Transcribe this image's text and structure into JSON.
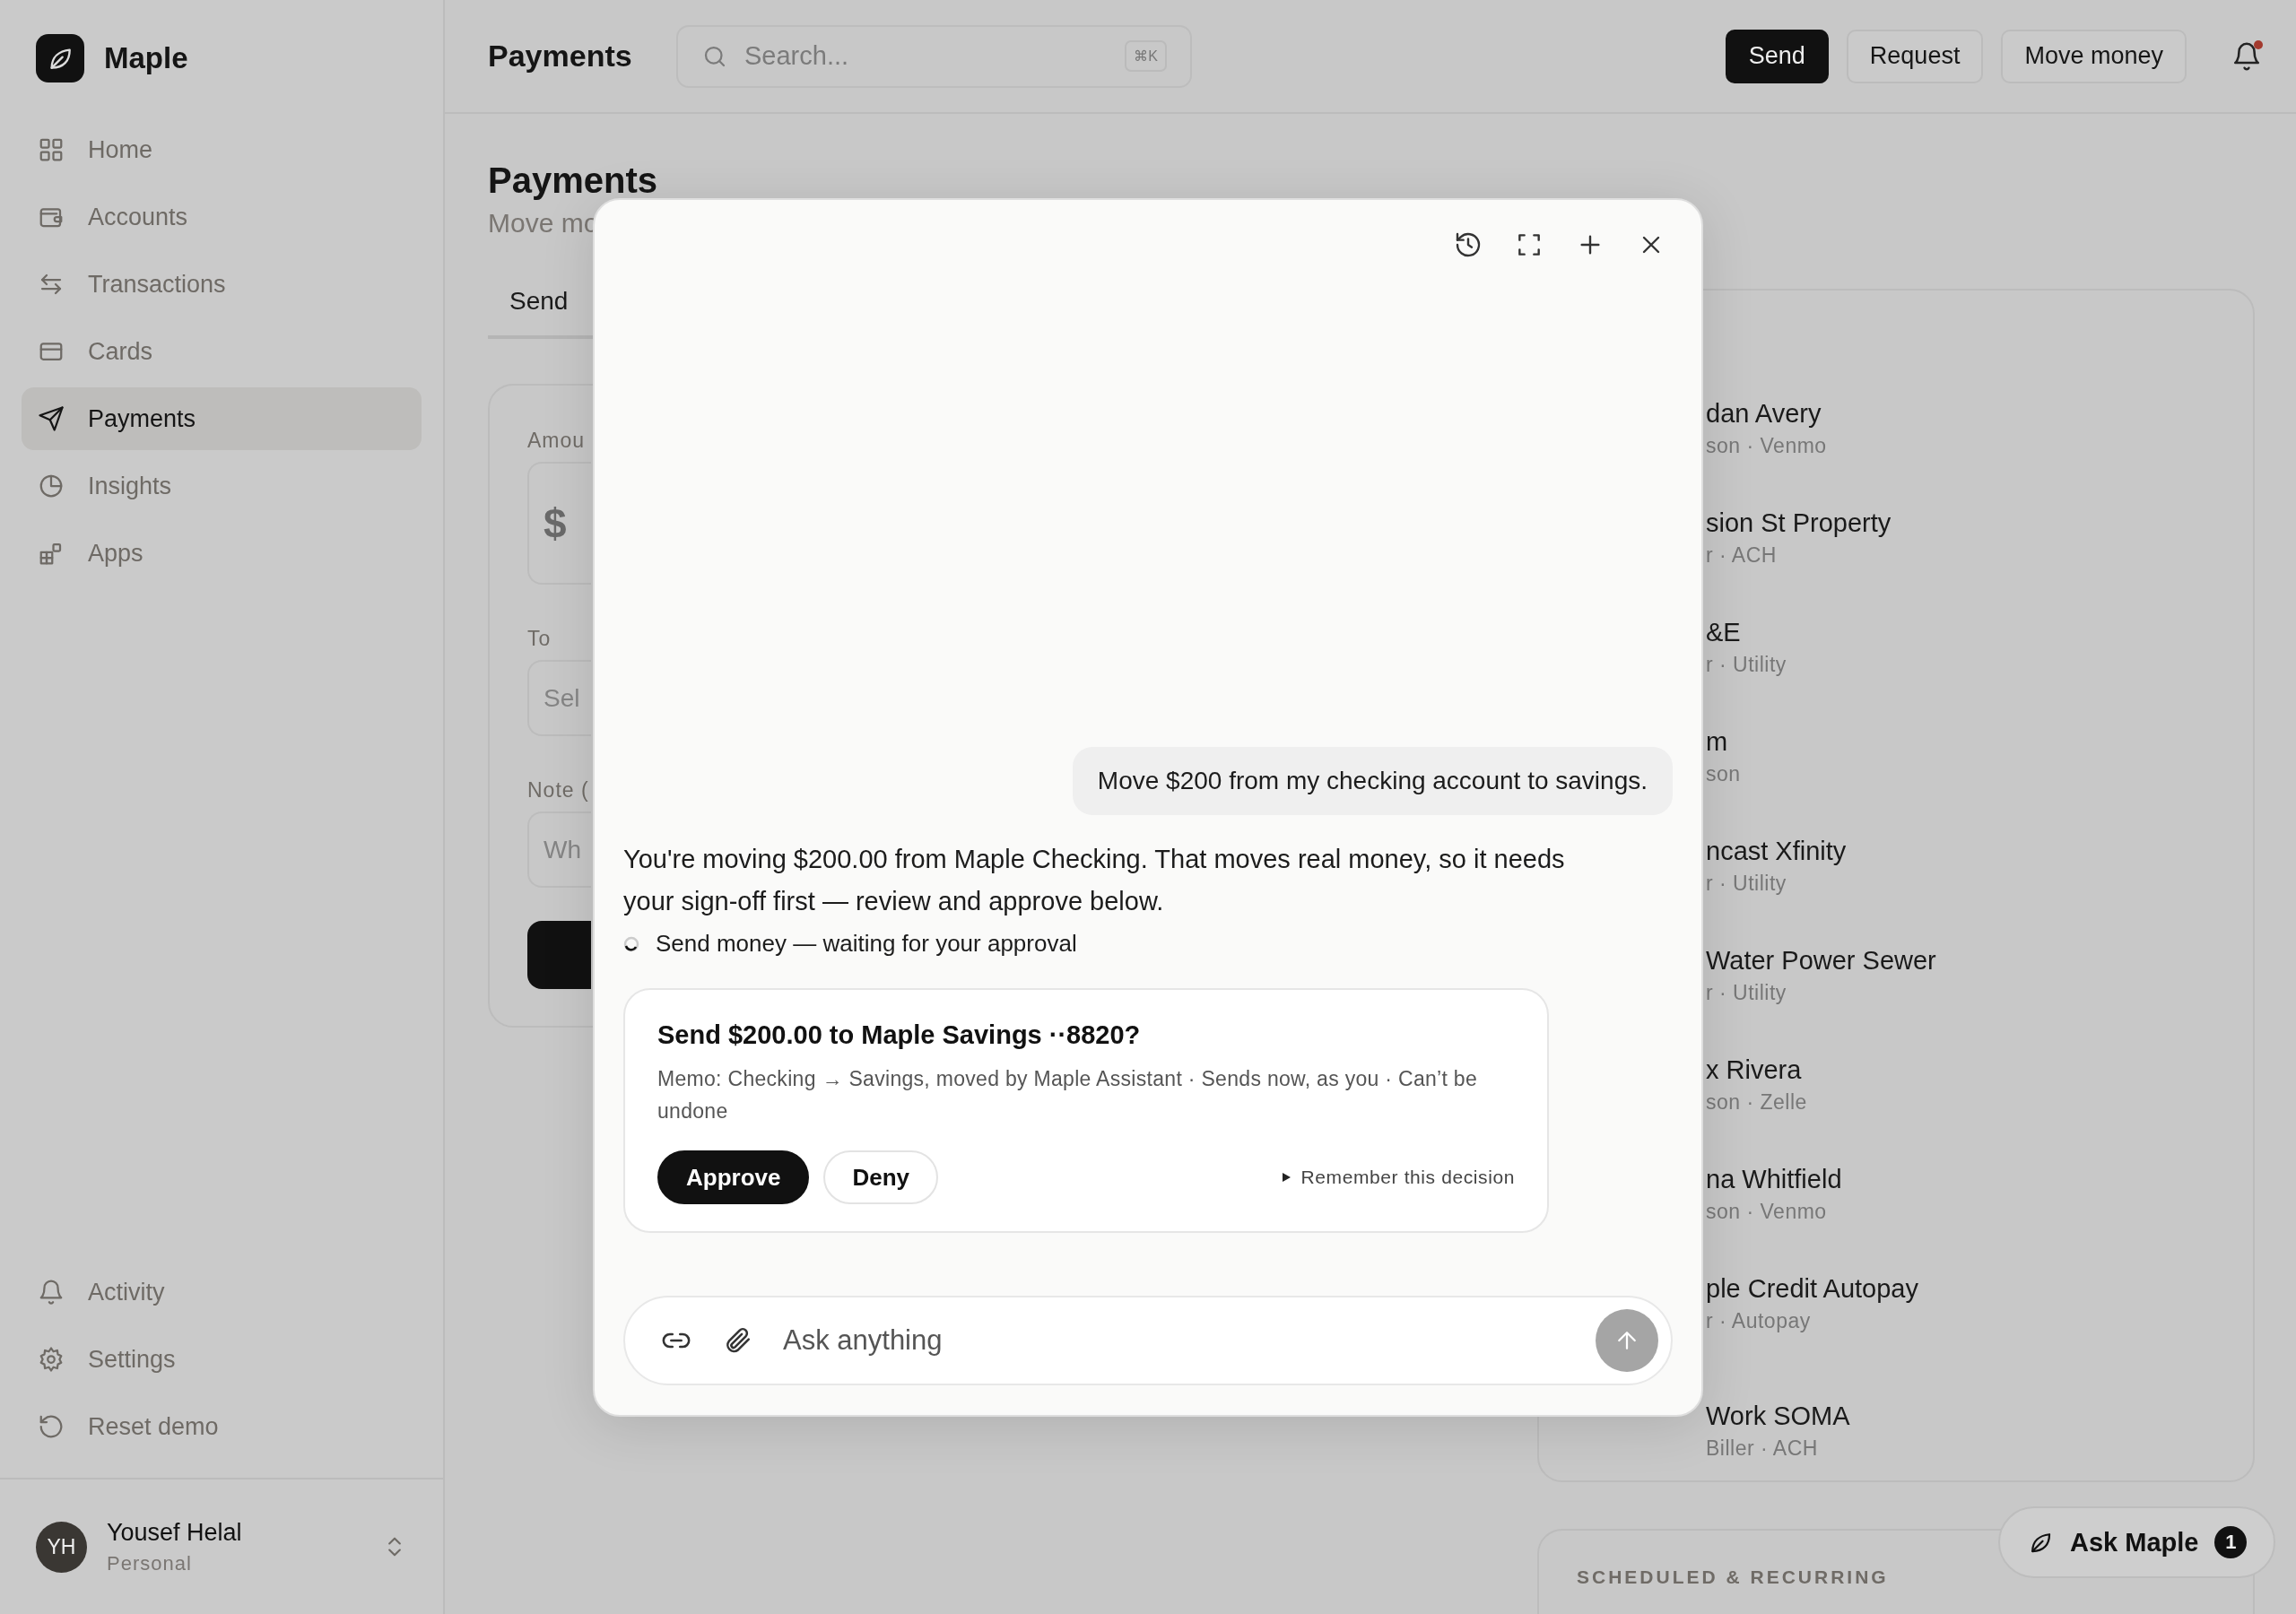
{
  "brand": {
    "name": "Maple"
  },
  "sidebar": {
    "items": [
      {
        "label": "Home",
        "selected": false
      },
      {
        "label": "Accounts",
        "selected": false
      },
      {
        "label": "Transactions",
        "selected": false
      },
      {
        "label": "Cards",
        "selected": false
      },
      {
        "label": "Payments",
        "selected": true
      },
      {
        "label": "Insights",
        "selected": false
      },
      {
        "label": "Apps",
        "selected": false
      }
    ],
    "footer_items": [
      {
        "label": "Activity"
      },
      {
        "label": "Settings"
      },
      {
        "label": "Reset demo"
      }
    ],
    "user": {
      "initials": "YH",
      "name": "Yousef Helal",
      "plan": "Personal"
    }
  },
  "topbar": {
    "title": "Payments",
    "search": {
      "placeholder": "Search...",
      "shortcut": "⌘K"
    },
    "actions": [
      {
        "label": "Send",
        "kind": "primary"
      },
      {
        "label": "Request",
        "kind": "secondary"
      },
      {
        "label": "Move money",
        "kind": "secondary"
      }
    ],
    "notifications": {
      "unread": true
    }
  },
  "page": {
    "title": "Payments",
    "subtitle": "Move mo",
    "tabs": [
      {
        "label": "Send",
        "selected": true
      }
    ],
    "form": {
      "fields": [
        {
          "label": "Amou",
          "value": "$",
          "kind": "amount"
        },
        {
          "label": "To",
          "placeholder": "Sel",
          "kind": "text"
        },
        {
          "label": "Note (",
          "placeholder": "Wh",
          "kind": "text"
        }
      ]
    },
    "recipients": [
      {
        "name": "dan Avery",
        "detail": "son · Venmo"
      },
      {
        "name": "sion St Property",
        "detail": "r · ACH"
      },
      {
        "name": "&E",
        "detail": "r · Utility"
      },
      {
        "name": "m",
        "detail": "son"
      },
      {
        "name": "ncast Xfinity",
        "detail": "r · Utility"
      },
      {
        "name": "Water Power Sewer",
        "detail": "r · Utility"
      },
      {
        "name": "x Rivera",
        "detail": "son · Zelle"
      },
      {
        "name": "na Whitfield",
        "detail": "son · Venmo"
      },
      {
        "name": "ple Credit Autopay",
        "detail": "r · Autopay"
      },
      {
        "name": "Work SOMA",
        "detail": "Biller · ACH"
      }
    ],
    "scheduled": {
      "title": "SCHEDULED & RECURRING"
    }
  },
  "assistant": {
    "messages": [
      {
        "kind": "user",
        "text": "Move $200 from my checking account to savings."
      },
      {
        "kind": "assistant",
        "text": "You're moving $200.00 from Maple Checking. That moves real money, so it needs your sign-off first — review and approve below."
      }
    ],
    "status": {
      "text": "Send money — waiting for your approval"
    },
    "approval": {
      "title": "Send $200.00 to Maple Savings ··8820?",
      "detail": "Memo: Checking → Savings, moved by Maple Assistant · Sends now, as you · Can’t be undone",
      "approve": "Approve",
      "deny": "Deny",
      "remember": "Remember this decision"
    },
    "composer": {
      "placeholder": "Ask anything"
    }
  },
  "ask_button": {
    "label": "Ask Maple",
    "badge": "1"
  }
}
